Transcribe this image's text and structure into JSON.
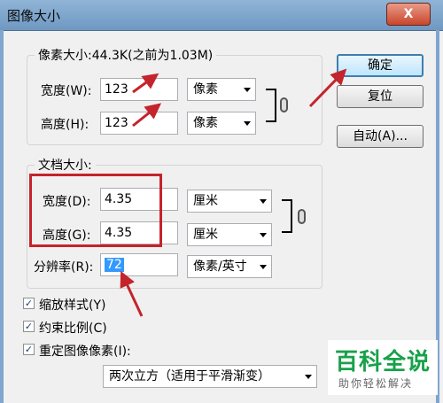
{
  "window": {
    "title": "图像大小",
    "close_label": "X"
  },
  "pixel_dimensions": {
    "legend": "像素大小:44.3K(之前为1.03M)",
    "width": {
      "label": "宽度(W):",
      "value": "123",
      "unit": "像素"
    },
    "height": {
      "label": "高度(H):",
      "value": "123",
      "unit": "像素"
    }
  },
  "document_size": {
    "legend": "文档大小:",
    "width": {
      "label": "宽度(D):",
      "value": "4.35",
      "unit": "厘米"
    },
    "height": {
      "label": "高度(G):",
      "value": "4.35",
      "unit": "厘米"
    },
    "resolution": {
      "label": "分辨率(R):",
      "value": "72",
      "unit": "像素/英寸"
    }
  },
  "buttons": {
    "ok": "确定",
    "reset": "复位",
    "auto": "自动(A)..."
  },
  "options": [
    {
      "label": "缩放样式(Y)",
      "checked": true
    },
    {
      "label": "约束比例(C)",
      "checked": true
    },
    {
      "label": "重定图像像素(I):",
      "checked": true
    }
  ],
  "resample_method": "两次立方（适用于平滑渐变）",
  "watermark": {
    "name": "百科全说",
    "slogan": "助你轻松解决"
  },
  "colors": {
    "annotation_red": "#c4242b",
    "title_bar": "#7ea6cf"
  },
  "icons": {
    "check": "✓",
    "chain": "chain-link-icon"
  }
}
